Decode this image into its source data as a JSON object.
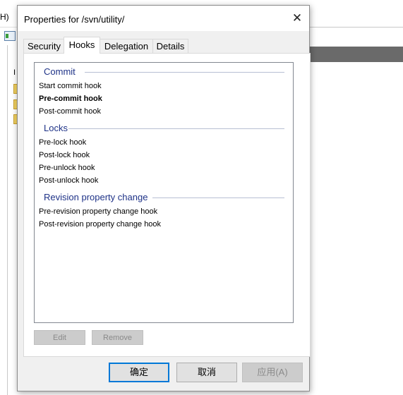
{
  "background": {
    "menu_fragment": "H)",
    "tree_fragment": "I"
  },
  "dialog": {
    "title": "Properties for /svn/utility/",
    "close_glyph": "✕",
    "tabs": [
      {
        "label": "Security",
        "active": false
      },
      {
        "label": "Hooks",
        "active": true
      },
      {
        "label": "Delegation",
        "active": false
      },
      {
        "label": "Details",
        "active": false
      }
    ],
    "hooks": {
      "groups": [
        {
          "title": "Commit",
          "items": [
            {
              "label": "Start commit hook",
              "bold": false
            },
            {
              "label": "Pre-commit hook",
              "bold": true
            },
            {
              "label": "Post-commit hook",
              "bold": false
            }
          ]
        },
        {
          "title": "Locks",
          "items": [
            {
              "label": "Pre-lock hook",
              "bold": false
            },
            {
              "label": "Post-lock hook",
              "bold": false
            },
            {
              "label": "Pre-unlock hook",
              "bold": false
            },
            {
              "label": "Post-unlock hook",
              "bold": false
            }
          ]
        },
        {
          "title": "Revision property change",
          "items": [
            {
              "label": "Pre-revision property change hook",
              "bold": false
            },
            {
              "label": "Post-revision property change hook",
              "bold": false
            }
          ]
        }
      ]
    },
    "panel_buttons": {
      "edit": "Edit",
      "remove": "Remove"
    },
    "buttons": {
      "ok": "确定",
      "cancel": "取消",
      "apply": "应用(A)"
    }
  }
}
